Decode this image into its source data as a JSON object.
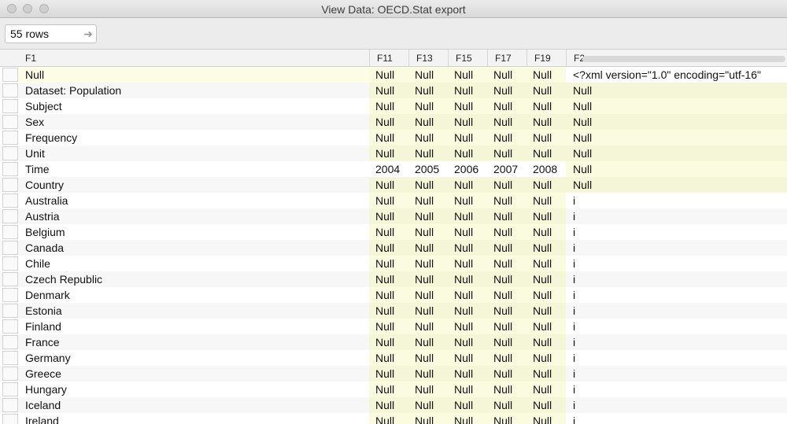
{
  "window": {
    "title": "View Data:  OECD.Stat export"
  },
  "toolbar": {
    "rows_value": "55 rows",
    "go_icon": "arrow-right-icon"
  },
  "columns": [
    "F1",
    "F11",
    "F13",
    "F15",
    "F17",
    "F19",
    "F2"
  ],
  "rows": [
    [
      "Null",
      "Null",
      "Null",
      "Null",
      "Null",
      "Null",
      "<?xml version=\"1.0\" encoding=\"utf-16\""
    ],
    [
      "Dataset: Population",
      "Null",
      "Null",
      "Null",
      "Null",
      "Null",
      "Null"
    ],
    [
      "Subject",
      "Null",
      "Null",
      "Null",
      "Null",
      "Null",
      "Null"
    ],
    [
      "Sex",
      "Null",
      "Null",
      "Null",
      "Null",
      "Null",
      "Null"
    ],
    [
      "Frequency",
      "Null",
      "Null",
      "Null",
      "Null",
      "Null",
      "Null"
    ],
    [
      "Unit",
      "Null",
      "Null",
      "Null",
      "Null",
      "Null",
      "Null"
    ],
    [
      "Time",
      "2004",
      "2005",
      "2006",
      "2007",
      "2008",
      "Null"
    ],
    [
      "Country",
      "Null",
      "Null",
      "Null",
      "Null",
      "Null",
      "Null"
    ],
    [
      "Australia",
      "Null",
      "Null",
      "Null",
      "Null",
      "Null",
      "i"
    ],
    [
      "Austria",
      "Null",
      "Null",
      "Null",
      "Null",
      "Null",
      "i"
    ],
    [
      "Belgium",
      "Null",
      "Null",
      "Null",
      "Null",
      "Null",
      "i"
    ],
    [
      "Canada",
      "Null",
      "Null",
      "Null",
      "Null",
      "Null",
      "i"
    ],
    [
      "Chile",
      "Null",
      "Null",
      "Null",
      "Null",
      "Null",
      "i"
    ],
    [
      "Czech Republic",
      "Null",
      "Null",
      "Null",
      "Null",
      "Null",
      "i"
    ],
    [
      "Denmark",
      "Null",
      "Null",
      "Null",
      "Null",
      "Null",
      "i"
    ],
    [
      "Estonia",
      "Null",
      "Null",
      "Null",
      "Null",
      "Null",
      "i"
    ],
    [
      "Finland",
      "Null",
      "Null",
      "Null",
      "Null",
      "Null",
      "i"
    ],
    [
      "France",
      "Null",
      "Null",
      "Null",
      "Null",
      "Null",
      "i"
    ],
    [
      "Germany",
      "Null",
      "Null",
      "Null",
      "Null",
      "Null",
      "i"
    ],
    [
      "Greece",
      "Null",
      "Null",
      "Null",
      "Null",
      "Null",
      "i"
    ],
    [
      "Hungary",
      "Null",
      "Null",
      "Null",
      "Null",
      "Null",
      "i"
    ],
    [
      "Iceland",
      "Null",
      "Null",
      "Null",
      "Null",
      "Null",
      "i"
    ],
    [
      "Ireland",
      "Null",
      "Null",
      "Null",
      "Null",
      "Null",
      "i"
    ]
  ],
  "colors": {
    "null_bg": "#fbfbe0",
    "alt_row": "#f7f7f7",
    "header_bg": "#f3f3f3"
  }
}
